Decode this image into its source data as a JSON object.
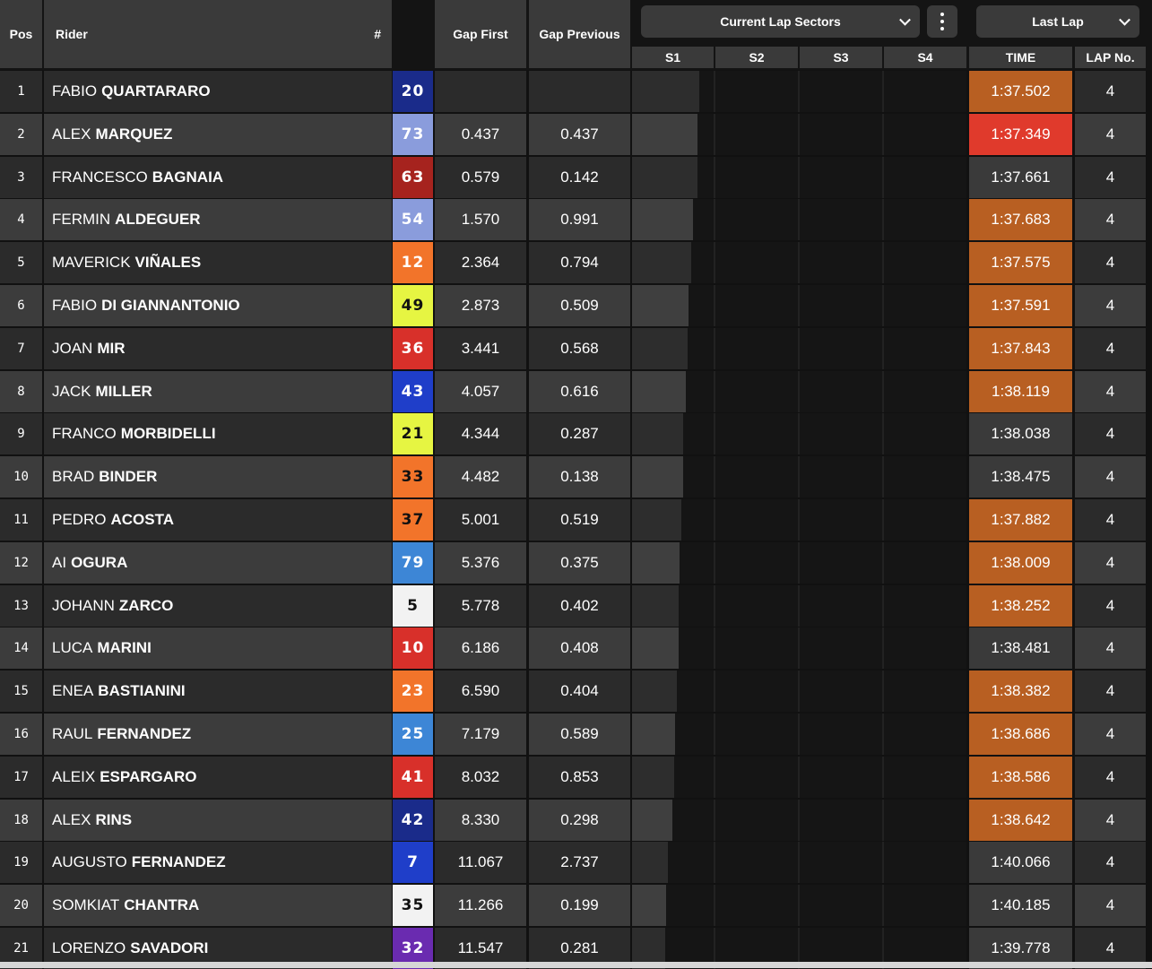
{
  "header": {
    "pos": "Pos",
    "rider": "Rider",
    "number": "#",
    "gap_first": "Gap First",
    "gap_previous": "Gap Previous",
    "sectors_dropdown": "Current Lap Sectors",
    "lap_dropdown": "Last Lap",
    "s1": "S1",
    "s2": "S2",
    "s3": "S3",
    "s4": "S4",
    "time": "TIME",
    "lap_no": "LAP No."
  },
  "colors": {
    "time_orange": "#b85f22",
    "time_red": "#e03a2c",
    "time_grey": "#3a3a3a"
  },
  "rows": [
    {
      "pos": "1",
      "first": "FABIO",
      "last": "QUARTARARO",
      "num": "20",
      "num_bg": "#1a2b8a",
      "num_fg": "#ffffff",
      "gap_first": "",
      "gap_prev": "",
      "time": "1:37.502",
      "time_bg": "orange",
      "lap": "4",
      "s1_progress": 0.81
    },
    {
      "pos": "2",
      "first": "ALEX",
      "last": "MARQUEZ",
      "num": "73",
      "num_bg": "#8a9cdc",
      "num_fg": "#ffffff",
      "gap_first": "0.437",
      "gap_prev": "0.437",
      "time": "1:37.349",
      "time_bg": "red",
      "lap": "4",
      "s1_progress": 0.79
    },
    {
      "pos": "3",
      "first": "FRANCESCO",
      "last": "BAGNAIA",
      "num": "63",
      "num_bg": "#a6231e",
      "num_fg": "#ffffff",
      "gap_first": "0.579",
      "gap_prev": "0.142",
      "time": "1:37.661",
      "time_bg": "grey",
      "lap": "4",
      "s1_progress": 0.79
    },
    {
      "pos": "4",
      "first": "FERMIN",
      "last": "ALDEGUER",
      "num": "54",
      "num_bg": "#8a9cdc",
      "num_fg": "#ffffff",
      "gap_first": "1.570",
      "gap_prev": "0.991",
      "time": "1:37.683",
      "time_bg": "orange",
      "lap": "4",
      "s1_progress": 0.73
    },
    {
      "pos": "5",
      "first": "MAVERICK",
      "last": "VIÑALES",
      "num": "12",
      "num_bg": "#f2742a",
      "num_fg": "#ffffff",
      "gap_first": "2.364",
      "gap_prev": "0.794",
      "time": "1:37.575",
      "time_bg": "orange",
      "lap": "4",
      "s1_progress": 0.71
    },
    {
      "pos": "6",
      "first": "FABIO",
      "last": "DI GIANNANTONIO",
      "num": "49",
      "num_bg": "#e6f542",
      "num_fg": "#111111",
      "gap_first": "2.873",
      "gap_prev": "0.509",
      "time": "1:37.591",
      "time_bg": "orange",
      "lap": "4",
      "s1_progress": 0.68
    },
    {
      "pos": "7",
      "first": "JOAN",
      "last": "MIR",
      "num": "36",
      "num_bg": "#d8302a",
      "num_fg": "#ffffff",
      "gap_first": "3.441",
      "gap_prev": "0.568",
      "time": "1:37.843",
      "time_bg": "orange",
      "lap": "4",
      "s1_progress": 0.67
    },
    {
      "pos": "8",
      "first": "JACK",
      "last": "MILLER",
      "num": "43",
      "num_bg": "#1f3ec9",
      "num_fg": "#ffffff",
      "gap_first": "4.057",
      "gap_prev": "0.616",
      "time": "1:38.119",
      "time_bg": "orange",
      "lap": "4",
      "s1_progress": 0.64
    },
    {
      "pos": "9",
      "first": "FRANCO",
      "last": "MORBIDELLI",
      "num": "21",
      "num_bg": "#e6f542",
      "num_fg": "#111111",
      "gap_first": "4.344",
      "gap_prev": "0.287",
      "time": "1:38.038",
      "time_bg": "grey",
      "lap": "4",
      "s1_progress": 0.61
    },
    {
      "pos": "10",
      "first": "BRAD",
      "last": "BINDER",
      "num": "33",
      "num_bg": "#f2742a",
      "num_fg": "#111111",
      "gap_first": "4.482",
      "gap_prev": "0.138",
      "time": "1:38.475",
      "time_bg": "grey",
      "lap": "4",
      "s1_progress": 0.61
    },
    {
      "pos": "11",
      "first": "PEDRO",
      "last": "ACOSTA",
      "num": "37",
      "num_bg": "#f2742a",
      "num_fg": "#111111",
      "gap_first": "5.001",
      "gap_prev": "0.519",
      "time": "1:37.882",
      "time_bg": "orange",
      "lap": "4",
      "s1_progress": 0.59
    },
    {
      "pos": "12",
      "first": "AI",
      "last": "OGURA",
      "num": "79",
      "num_bg": "#3d86d6",
      "num_fg": "#ffffff",
      "gap_first": "5.376",
      "gap_prev": "0.375",
      "time": "1:38.009",
      "time_bg": "orange",
      "lap": "4",
      "s1_progress": 0.57
    },
    {
      "pos": "13",
      "first": "JOHANN",
      "last": "ZARCO",
      "num": "5",
      "num_bg": "#f2f2f2",
      "num_fg": "#111111",
      "gap_first": "5.778",
      "gap_prev": "0.402",
      "time": "1:38.252",
      "time_bg": "orange",
      "lap": "4",
      "s1_progress": 0.56
    },
    {
      "pos": "14",
      "first": "LUCA",
      "last": "MARINI",
      "num": "10",
      "num_bg": "#d8302a",
      "num_fg": "#ffffff",
      "gap_first": "6.186",
      "gap_prev": "0.408",
      "time": "1:38.481",
      "time_bg": "grey",
      "lap": "4",
      "s1_progress": 0.56
    },
    {
      "pos": "15",
      "first": "ENEA",
      "last": "BASTIANINI",
      "num": "23",
      "num_bg": "#f2742a",
      "num_fg": "#ffffff",
      "gap_first": "6.590",
      "gap_prev": "0.404",
      "time": "1:38.382",
      "time_bg": "orange",
      "lap": "4",
      "s1_progress": 0.54
    },
    {
      "pos": "16",
      "first": "RAUL",
      "last": "FERNANDEZ",
      "num": "25",
      "num_bg": "#3d86d6",
      "num_fg": "#ffffff",
      "gap_first": "7.179",
      "gap_prev": "0.589",
      "time": "1:38.686",
      "time_bg": "orange",
      "lap": "4",
      "s1_progress": 0.52
    },
    {
      "pos": "17",
      "first": "ALEIX",
      "last": "ESPARGARO",
      "num": "41",
      "num_bg": "#d8302a",
      "num_fg": "#ffffff",
      "gap_first": "8.032",
      "gap_prev": "0.853",
      "time": "1:38.586",
      "time_bg": "orange",
      "lap": "4",
      "s1_progress": 0.5
    },
    {
      "pos": "18",
      "first": "ALEX",
      "last": "RINS",
      "num": "42",
      "num_bg": "#1a2b8a",
      "num_fg": "#ffffff",
      "gap_first": "8.330",
      "gap_prev": "0.298",
      "time": "1:38.642",
      "time_bg": "orange",
      "lap": "4",
      "s1_progress": 0.48
    },
    {
      "pos": "19",
      "first": "AUGUSTO",
      "last": "FERNANDEZ",
      "num": "7",
      "num_bg": "#1f3ec9",
      "num_fg": "#ffffff",
      "gap_first": "11.067",
      "gap_prev": "2.737",
      "time": "1:40.066",
      "time_bg": "grey",
      "lap": "4",
      "s1_progress": 0.43
    },
    {
      "pos": "20",
      "first": "SOMKIAT",
      "last": "CHANTRA",
      "num": "35",
      "num_bg": "#f2f2f2",
      "num_fg": "#111111",
      "gap_first": "11.266",
      "gap_prev": "0.199",
      "time": "1:40.185",
      "time_bg": "grey",
      "lap": "4",
      "s1_progress": 0.41
    },
    {
      "pos": "21",
      "first": "LORENZO",
      "last": "SAVADORI",
      "num": "32",
      "num_bg": "#6a2bb0",
      "num_fg": "#ffffff",
      "gap_first": "11.547",
      "gap_prev": "0.281",
      "time": "1:39.778",
      "time_bg": "grey",
      "lap": "4",
      "s1_progress": 0.4
    }
  ]
}
